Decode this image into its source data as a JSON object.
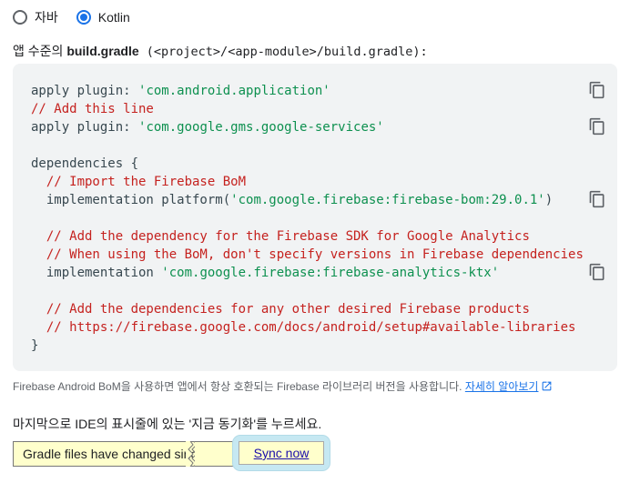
{
  "language_toggle": {
    "options": [
      {
        "label": "자바",
        "selected": false
      },
      {
        "label": "Kotlin",
        "selected": true
      }
    ]
  },
  "caption": {
    "prefix": "앱 수준의 ",
    "bold": "build.gradle",
    "path": " (<project>/<app-module>/build.gradle):"
  },
  "code": {
    "line1_kw": "apply plugin: ",
    "line1_str": "'com.android.application'",
    "line2_cmt": "// Add this line",
    "line3_kw": "apply plugin: ",
    "line3_str": "'com.google.gms.google-services'",
    "line5": "dependencies {",
    "line6_cmt": "// Import the Firebase BoM",
    "line7_kw": "implementation platform(",
    "line7_str": "'com.google.firebase:firebase-bom:29.0.1'",
    "line7_end": ")",
    "line9_cmt": "// Add the dependency for the Firebase SDK for Google Analytics",
    "line10_cmt": "// When using the BoM, don't specify versions in Firebase dependencies",
    "line11_kw": "implementation ",
    "line11_str": "'com.google.firebase:firebase-analytics-ktx'",
    "line13_cmt": "// Add the dependencies for any other desired Firebase products",
    "line14_cmt": "// https://firebase.google.com/docs/android/setup#available-libraries",
    "line15": "}"
  },
  "note": {
    "text": "Firebase Android BoM을 사용하면 앱에서 항상 호환되는 Firebase 라이브러리 버전을 사용합니다. ",
    "link": "자세히 알아보기"
  },
  "instruction": "마지막으로 IDE의 표시줄에 있는 '지금 동기화'를 누르세요.",
  "banner": {
    "message": "Gradle files have changed since last project sync",
    "sync_label": "Sync now"
  },
  "colors": {
    "accent": "#1a73e8",
    "string": "#0d904f",
    "comment": "#c5221f",
    "code_bg": "#f1f3f4",
    "banner_bg": "#ffffcc"
  }
}
